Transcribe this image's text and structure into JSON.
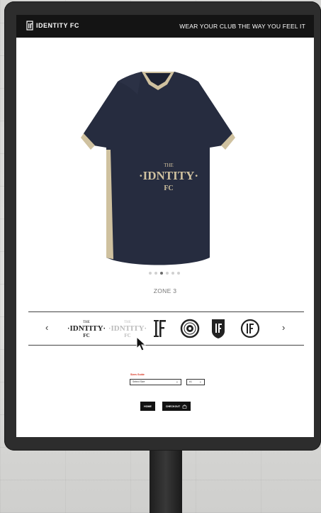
{
  "header": {
    "brand": "IDENTITY FC",
    "tagline": "WEAR YOUR CLUB THE WAY YOU FEEL IT"
  },
  "product": {
    "jersey_crest_top": "THE",
    "jersey_crest_main": "·IDNTITY·",
    "jersey_crest_bottom": "FC",
    "colors": {
      "body": "#262c3f",
      "trim": "#cfc19f"
    }
  },
  "gallery": {
    "dot_count": 6,
    "active_dot": 2,
    "zone_label": "ZONE 3"
  },
  "logo_carousel": {
    "prev_label": "‹",
    "next_label": "›",
    "options": [
      {
        "icon": "identity-fc-wordmark-icon",
        "text_top": "THE",
        "text_main": "·IDNTITY·",
        "text_bottom": "FC",
        "state": "default"
      },
      {
        "icon": "identity-fc-wordmark-faded-icon",
        "text_top": "THE",
        "text_main": "·IDNTITY·",
        "text_bottom": "FC",
        "state": "hover"
      },
      {
        "icon": "if-monogram-icon",
        "state": "default"
      },
      {
        "icon": "round-badge-icon",
        "state": "default"
      },
      {
        "icon": "shield-crest-icon",
        "state": "default"
      },
      {
        "icon": "ifc-circle-monogram-icon",
        "state": "default"
      }
    ]
  },
  "order": {
    "size_guide_label": "Sizes Guide",
    "size_select_value": "Select Size",
    "qty_select_value": "#1",
    "home_label": "HOME",
    "checkout_label": "CHECKOUT"
  }
}
